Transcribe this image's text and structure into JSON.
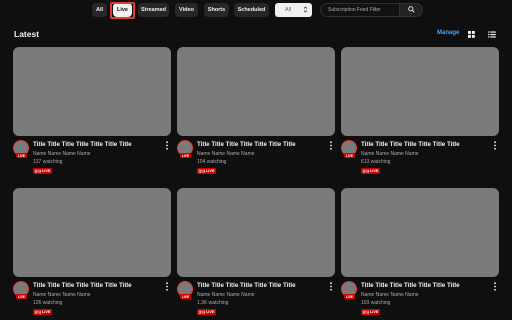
{
  "filters": {
    "chips": [
      {
        "label": "All",
        "active": false
      },
      {
        "label": "Live",
        "active": true
      },
      {
        "label": "Streamed",
        "active": false
      },
      {
        "label": "Video",
        "active": false
      },
      {
        "label": "Shorts",
        "active": false
      },
      {
        "label": "Scheduled",
        "active": false
      }
    ],
    "select_value": "All",
    "search_placeholder": "Subscription Feed Filter",
    "icons": {
      "search": "search-icon",
      "caret": "chevron-down-icon"
    }
  },
  "section": {
    "title": "Latest",
    "manage_label": "Manage",
    "view_icons": [
      "grid-view-icon",
      "list-view-icon"
    ]
  },
  "colors": {
    "background": "#0f0f0f",
    "thumbnail": "#7a7a7a",
    "live_red": "#cc0000",
    "highlight": "#e53935",
    "link_blue": "#3ea6ff"
  },
  "cards": [
    {
      "title": "Title Title Title Title Title Title Title",
      "channel": "Name Name Name Name",
      "views": "137 watching",
      "badge": "LIVE",
      "avatar_badge": "LIVE"
    },
    {
      "title": "Title Title Title Title Title Title Title",
      "channel": "Name Name Name Name",
      "views": "104 watching",
      "badge": "LIVE",
      "avatar_badge": "LIVE"
    },
    {
      "title": "Title Title Title Title Title Title Title",
      "channel": "Name Name Name Name",
      "views": "613 watching",
      "badge": "LIVE",
      "avatar_badge": "LIVE"
    },
    {
      "title": "Title Title Title Title Title Title Title",
      "channel": "Name Name Name Name",
      "views": "126 watching",
      "badge": "LIVE",
      "avatar_badge": "LIVE"
    },
    {
      "title": "Title Title Title Title Title Title Title",
      "channel": "Name Name Name Name",
      "views": "1.3K watching",
      "badge": "LIVE",
      "avatar_badge": "LIVE"
    },
    {
      "title": "Title Title Title Title Title Title Title",
      "channel": "Name Name Name Name",
      "views": "103 watching",
      "badge": "LIVE",
      "avatar_badge": "LIVE"
    }
  ]
}
